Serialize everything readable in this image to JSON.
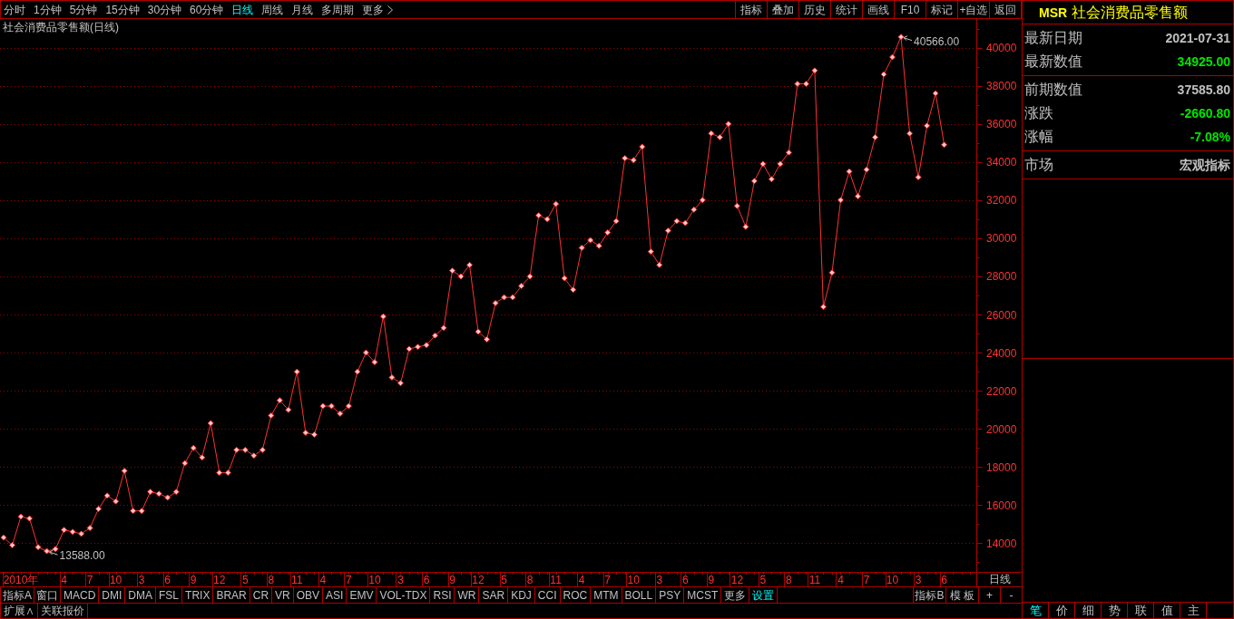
{
  "toolbar": {
    "periods": [
      {
        "label": "分时",
        "selected": false
      },
      {
        "label": "1分钟",
        "selected": false
      },
      {
        "label": "5分钟",
        "selected": false
      },
      {
        "label": "15分钟",
        "selected": false
      },
      {
        "label": "30分钟",
        "selected": false
      },
      {
        "label": "60分钟",
        "selected": false
      },
      {
        "label": "日线",
        "selected": true
      },
      {
        "label": "周线",
        "selected": false
      },
      {
        "label": "月线",
        "selected": false
      },
      {
        "label": "多周期",
        "selected": false
      }
    ],
    "more": "更多",
    "buttons": [
      "指标",
      "叠加",
      "历史",
      "统计",
      "画线",
      "F10",
      "标记",
      "+自选",
      "返回"
    ]
  },
  "chart": {
    "period_label": "日线",
    "chart_data": {
      "type": "line",
      "title": "社会消费品零售额(日线)",
      "grid": true,
      "marker": "diamond",
      "categories": [
        null,
        null,
        "2010年",
        null,
        null,
        null,
        null,
        "4",
        null,
        null,
        "7",
        null,
        null,
        "10",
        null,
        null,
        "3",
        null,
        null,
        "6",
        null,
        null,
        "9",
        null,
        null,
        "12",
        null,
        null,
        "5",
        null,
        null,
        "8",
        null,
        null,
        "11",
        null,
        null,
        "4",
        null,
        null,
        "7",
        null,
        null,
        "10",
        null,
        null,
        "3",
        null,
        null,
        "6",
        null,
        null,
        "9",
        null,
        null,
        "12",
        null,
        null,
        "5",
        null,
        null,
        "8",
        null,
        null,
        "11",
        null,
        null,
        "4",
        null,
        null,
        "7",
        null,
        null,
        "10",
        null,
        null,
        "3",
        null,
        null,
        "6",
        null,
        null,
        "9",
        null,
        null,
        "12",
        null,
        null,
        "5",
        null,
        null,
        "8",
        null,
        null,
        "11",
        null,
        null,
        "4",
        null,
        null,
        "7",
        null,
        null,
        "10",
        null,
        null,
        "3",
        null,
        null,
        "6"
      ],
      "values": [
        14300,
        13900,
        15400,
        15300,
        13800,
        13588,
        13700,
        14700,
        14600,
        14500,
        14800,
        15800,
        16500,
        16200,
        17800,
        15700,
        15700,
        16700,
        16600,
        16400,
        16700,
        18200,
        19000,
        18500,
        20300,
        17700,
        17700,
        18900,
        18900,
        18600,
        18900,
        20700,
        21500,
        21000,
        23000,
        19800,
        19700,
        21200,
        21200,
        20800,
        21200,
        23000,
        24000,
        23500,
        25900,
        22700,
        22400,
        24200,
        24300,
        24400,
        24900,
        25300,
        28300,
        28000,
        28600,
        25100,
        24700,
        26600,
        26900,
        26900,
        27500,
        28000,
        31200,
        31000,
        31800,
        27900,
        27300,
        29500,
        29900,
        29600,
        30300,
        30900,
        34200,
        34100,
        34800,
        29300,
        28600,
        30400,
        30900,
        30800,
        31500,
        32000,
        35500,
        35300,
        36000,
        31700,
        30600,
        33000,
        33900,
        33100,
        33900,
        34500,
        38100,
        38100,
        38800,
        26400,
        28200,
        32000,
        33500,
        32200,
        33600,
        35300,
        38600,
        39500,
        40566,
        35500,
        33200,
        35900,
        37600,
        34900
      ],
      "ylim": [
        12500,
        41500
      ],
      "yticks": [
        14000,
        16000,
        18000,
        20000,
        22000,
        24000,
        26000,
        28000,
        30000,
        32000,
        34000,
        36000,
        38000,
        40000
      ],
      "annotations": [
        "40566.00",
        "13588.00"
      ]
    }
  },
  "indicator_bar": {
    "left_buttons": [
      "指标A",
      "窗口"
    ],
    "indicators": [
      "MACD",
      "DMI",
      "DMA",
      "FSL",
      "TRIX",
      "BRAR",
      "CR",
      "VR",
      "OBV",
      "ASI",
      "EMV",
      "VOL-TDX",
      "RSI",
      "WR",
      "SAR",
      "KDJ",
      "CCI",
      "ROC",
      "MTM",
      "BOLL",
      "PSY",
      "MCST"
    ],
    "more": "更多",
    "settings": "设置",
    "right_buttons": [
      "指标B",
      "模 板",
      "+",
      "-"
    ]
  },
  "bottom_bar": {
    "buttons": [
      "扩展∧",
      "关联报价"
    ]
  },
  "info_panel": {
    "code": "MSR",
    "name": "社会消费品零售额",
    "sections": [
      [
        {
          "label": "最新日期",
          "value": "2021-07-31",
          "color": "#c0c0c0"
        },
        {
          "label": "最新数值",
          "value": "34925.00",
          "color": "#00e600"
        }
      ],
      [
        {
          "label": "前期数值",
          "value": "37585.80",
          "color": "#c0c0c0"
        },
        {
          "label": "涨跌",
          "value": "-2660.80",
          "color": "#00e600"
        },
        {
          "label": "涨幅",
          "value": "-7.08%",
          "color": "#00e600"
        }
      ],
      [
        {
          "label": "市场",
          "value": "宏观指标",
          "color": "#c0c0c0"
        }
      ]
    ],
    "tabs": [
      {
        "label": "笔",
        "selected": true
      },
      {
        "label": "价",
        "selected": false
      },
      {
        "label": "细",
        "selected": false
      },
      {
        "label": "势",
        "selected": false
      },
      {
        "label": "联",
        "selected": false
      },
      {
        "label": "值",
        "selected": false
      },
      {
        "label": "主",
        "selected": false
      }
    ]
  }
}
